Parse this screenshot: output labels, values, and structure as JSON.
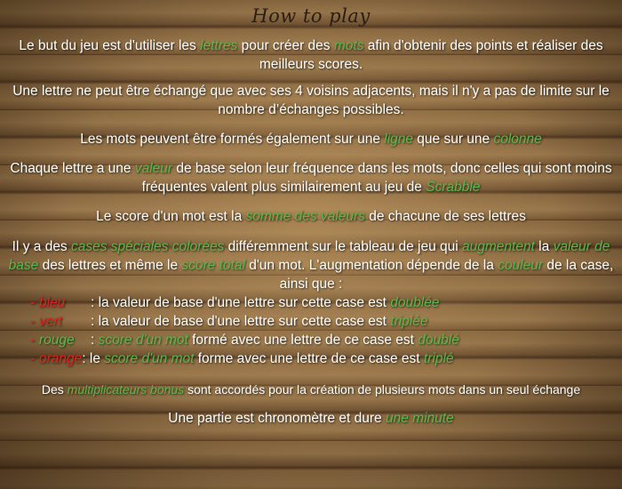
{
  "title": "How to play",
  "p1": {
    "a": "Le but du jeu est d'utiliser les ",
    "b": "lettres",
    "c": " pour créer des ",
    "d": "mots",
    "e": " afin d'obtenir des points et réaliser des meilleurs scores."
  },
  "p2": "Une lettre ne peut être échangé que avec ses 4 voisins adjacents, mais il n'y a pas de limite sur le nombre d’échanges possibles.",
  "p3": {
    "a": "Les mots peuvent être formés également sur une ",
    "b": "ligne",
    "c": " que sur une ",
    "d": "colonne"
  },
  "p4": {
    "a": "Chaque lettre a une ",
    "b": "valeur",
    "c": " de base selon leur fréquence dans les mots, donc celles qui sont moins fréquentes valent plus similairement au jeu de ",
    "d": "Scrabble"
  },
  "p5": {
    "a": "Le score d'un mot est la ",
    "b": "somme des valeurs",
    "c": " de chacune de ses lettres"
  },
  "p6": {
    "a": "Il y a des ",
    "b": "cases spéciales colorées",
    "c": " différemment sur le tableau de jeu qui ",
    "d": "augmentent",
    "e": " la ",
    "f": "valeur de base",
    "g": " des lettres et même le ",
    "h": "score total",
    "i": " d'un mot. L'augmentation dépende de la ",
    "j": "couleur",
    "k": " de la case, ainsi que :"
  },
  "colors": [
    {
      "name": "bleu",
      "text": ": la valeur de base d'une lettre sur cette case est ",
      "effect": "doublée",
      "suffix": ""
    },
    {
      "name": "vert",
      "text": ": la valeur de base d'une lettre sur cette case est ",
      "effect": "triplée",
      "suffix": ""
    },
    {
      "name": "rouge",
      "pre": ": ",
      "scoreword": "score d'un mot",
      "text": " formé avec une lettre de ce case est ",
      "effect": "doublé"
    },
    {
      "name": "orange",
      "pre": ": le ",
      "scoreword": "score d'un mot",
      "text": " forme avec une lettre de ce case est ",
      "effect": "triplé"
    }
  ],
  "p7": {
    "a": "Des ",
    "b": "multiplicateurs bonus",
    "c": " sont accordés pour la création de plusieurs mots dans un seul échange"
  },
  "p8": {
    "a": "Une partie est chronomètre et dure ",
    "b": "une minute"
  },
  "accent_colors": {
    "green": "#5cb84a",
    "red": "#e0241e"
  }
}
